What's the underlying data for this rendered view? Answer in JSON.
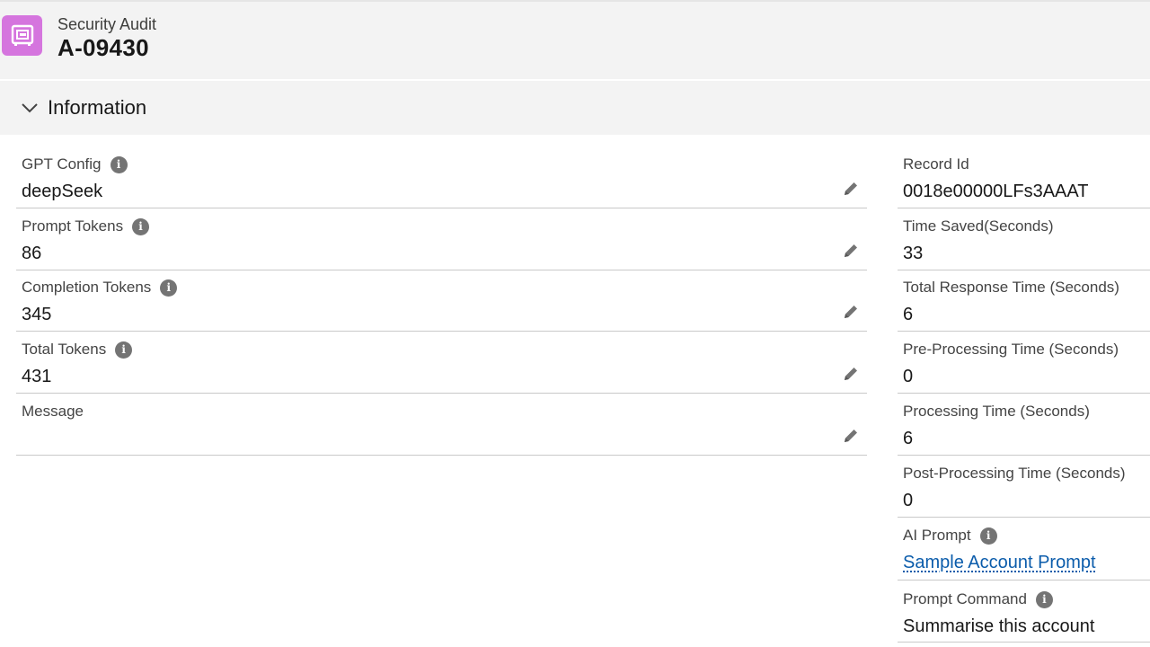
{
  "header": {
    "object_type": "Security Audit",
    "record_name": "A-09430",
    "icon": "record-icon",
    "icon_color": "#d575de"
  },
  "section": {
    "title": "Information",
    "expanded": true
  },
  "left_fields": [
    {
      "label": "GPT Config",
      "value": "deepSeek",
      "has_info": true,
      "editable": true
    },
    {
      "label": "Prompt Tokens",
      "value": "86",
      "has_info": true,
      "editable": true
    },
    {
      "label": "Completion Tokens",
      "value": "345",
      "has_info": true,
      "editable": true
    },
    {
      "label": "Total Tokens",
      "value": "431",
      "has_info": true,
      "editable": true
    },
    {
      "label": "Message",
      "value": "",
      "has_info": false,
      "editable": true
    }
  ],
  "right_fields": [
    {
      "label": "Record Id",
      "value": "0018e00000LFs3AAAT",
      "has_info": false
    },
    {
      "label": "Time Saved(Seconds)",
      "value": "33",
      "has_info": false
    },
    {
      "label": "Total Response Time (Seconds)",
      "value": "6",
      "has_info": false
    },
    {
      "label": "Pre-Processing Time (Seconds)",
      "value": "0",
      "has_info": false
    },
    {
      "label": "Processing Time (Seconds)",
      "value": "6",
      "has_info": false
    },
    {
      "label": "Post-Processing Time (Seconds)",
      "value": "0",
      "has_info": false
    },
    {
      "label": "AI Prompt",
      "value": "Sample Account Prompt",
      "has_info": true,
      "is_link": true
    },
    {
      "label": "Prompt Command",
      "value": "Summarise this account",
      "has_info": true
    }
  ],
  "info_glyph": "i",
  "colors": {
    "link": "#0b5cab",
    "header_bg": "#f3f3f3"
  }
}
